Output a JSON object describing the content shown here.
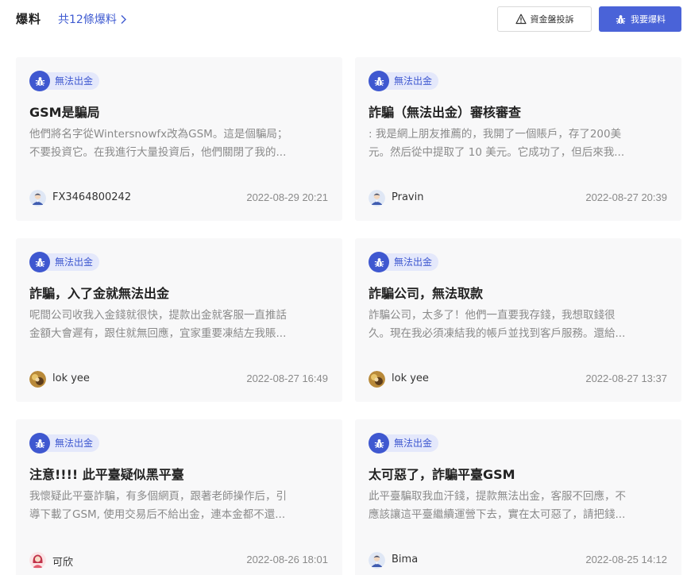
{
  "header": {
    "title": "爆料",
    "count_link": "共12條爆料",
    "complaint_button": "資金盤投訴",
    "report_button": "我要爆料"
  },
  "colors": {
    "accent": "#3f58d0",
    "tag_bg": "#e4e8fb",
    "card_bg": "#f8f8f9"
  },
  "cards": [
    {
      "tag": "無法出金",
      "title": "GSM是騙局",
      "desc1": "他們將名字從Wintersnowfx改為GSM。這是個騙局；",
      "desc2": "不要投資它。在我進行大量投資后，他們關閉了我的...",
      "author": "FX3464800242",
      "date": "2022-08-29 20:21",
      "avatar": "default-user-avatar"
    },
    {
      "tag": "無法出金",
      "title": "詐騙（無法出金）審核審查",
      "desc1": ": 我是網上朋友推薦的，我開了一個賬戶，存了200美",
      "desc2": "元。然后從中提取了 10 美元。它成功了，但后來我...",
      "author": "Pravin",
      "date": "2022-08-27 20:39",
      "avatar": "default-user-avatar"
    },
    {
      "tag": "無法出金",
      "title": "詐騙，入了金就無法出金",
      "desc1": "呢間公司收我入金錢就很快，提款出金就客服一直推話",
      "desc2": "金額大會遲有，跟住就無回應，宜家重要凍結左我賬...",
      "author": "lok yee",
      "date": "2022-08-27 16:49",
      "avatar": "photo-avatar"
    },
    {
      "tag": "無法出金",
      "title": "詐騙公司，無法取款",
      "desc1": "詐騙公司，太多了！他們一直要我存錢，我想取錢很",
      "desc2": "久。現在我必須凍結我的帳戶並找到客戶服務。還給...",
      "author": "lok yee",
      "date": "2022-08-27 13:37",
      "avatar": "photo-avatar"
    },
    {
      "tag": "無法出金",
      "title": "注意!!!! 此平臺疑似黑平臺",
      "desc1": "我懷疑此平臺詐騙，有多個網頁，跟著老師操作后，引",
      "desc2": "導下載了GSM, 使用交易后不給出金，連本金都不還...",
      "author": "可欣",
      "date": "2022-08-26 18:01",
      "avatar": "female-user-avatar"
    },
    {
      "tag": "無法出金",
      "title": "太可惡了，詐騙平臺GSM",
      "desc1": "此平臺騙取我血汗錢，提款無法出金，客服不回應，不",
      "desc2": "應該讓這平臺繼續運營下去，實在太可惡了，請把錢...",
      "author": "Bima",
      "date": "2022-08-25 14:12",
      "avatar": "default-user-avatar"
    }
  ]
}
